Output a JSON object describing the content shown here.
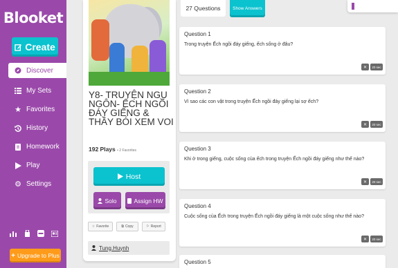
{
  "sidebar": {
    "brand": "Blooket",
    "create_label": "Create",
    "items": [
      {
        "label": "Discover",
        "icon": "compass-icon",
        "active": true
      },
      {
        "label": "My Sets",
        "icon": "list-icon"
      },
      {
        "label": "Favorites",
        "icon": "star-icon"
      },
      {
        "label": "History",
        "icon": "history-icon"
      },
      {
        "label": "Homework",
        "icon": "homework-icon"
      },
      {
        "label": "Play",
        "icon": "play-icon"
      },
      {
        "label": "Settings",
        "icon": "gear-icon"
      }
    ],
    "bottom_icons": [
      "stats-icon",
      "market-icon",
      "blooks-icon",
      "news-icon"
    ],
    "upgrade_label": "Upgrade to Plus"
  },
  "set": {
    "title": "Y8- TRUYỆN NGỤ NGÔN- ẾCH NGỒI ĐÁY GIẾNG & THẦY BÓI XEM VOI",
    "plays": "192 Plays",
    "favorites": "• 2 Favorites",
    "host_label": "Host",
    "solo_label": "Solo",
    "assign_label": "Assign HW",
    "favorite_label": "Favorite",
    "copy_label": "Copy",
    "report_label": "Report",
    "author": "Tung.Huynh"
  },
  "top": {
    "question_count": "27 Questions",
    "show_answers": "Show Answers"
  },
  "questions": [
    {
      "header": "Question 1",
      "text": "Trong truyện Ếch ngồi đáy giếng, ếch sống ở đâu?",
      "time": "20 sec"
    },
    {
      "header": "Question 2",
      "text": "Vì sao các con vật trong truyện Ếch ngồi đáy giếng lại sợ ếch?",
      "time": "20 sec"
    },
    {
      "header": "Question 3",
      "text": "Khi ở trong giếng, cuộc sống của ếch trong truyện Ếch ngồi đáy giếng như thế nào?",
      "time": "20 sec"
    },
    {
      "header": "Question 4",
      "text": "Cuộc sống của Ếch trong truyện Ếch ngồi đáy giếng là một cuộc sống như thế nào?",
      "time": "20 sec"
    },
    {
      "header": "Question 5"
    }
  ],
  "colors": {
    "sidebar": "#9a49aa",
    "accent": "#0bc2cf",
    "upgrade": "#ff9b1a",
    "background": "#ebebeb"
  }
}
